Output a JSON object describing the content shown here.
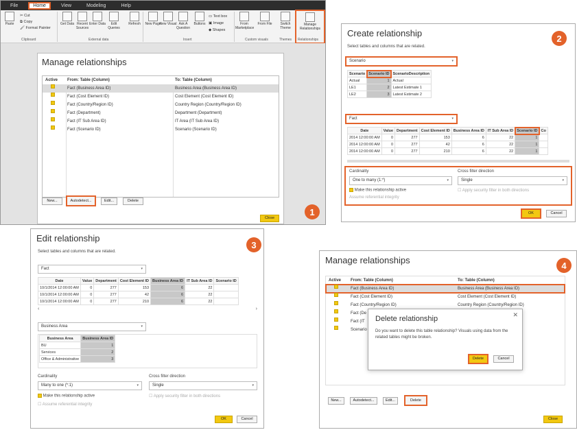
{
  "accent": "#e3622a",
  "yellow": "#f2c811",
  "steps": [
    "1",
    "2",
    "3",
    "4"
  ],
  "panel1": {
    "menu": [
      "File",
      "Home",
      "View",
      "Modeling",
      "Help"
    ],
    "ribbon": {
      "paste": "Paste",
      "cut": "Cut",
      "copy": "Copy",
      "format_painter": "Format Painter",
      "buttons": [
        "Get Data",
        "Recent Sources",
        "Enter Data",
        "Edit Queries",
        "Refresh",
        "New Page",
        "New Visual",
        "Ask A Question",
        "Buttons",
        "From Marketplace",
        "From File",
        "Switch Theme",
        "Manage Relationships"
      ],
      "text_box": "Text box",
      "image": "Image",
      "shapes": "Shapes",
      "groups": [
        "Clipboard",
        "External data",
        "Insert",
        "Custom visuals",
        "Themes",
        "Relationships"
      ]
    },
    "dialog": {
      "title": "Manage relationships",
      "col_active": "Active",
      "col_from": "From: Table (Column)",
      "col_to": "To: Table (Column)",
      "rows": [
        {
          "from": "Fact (Business Area ID)",
          "to": "Business Area (Business Area ID)"
        },
        {
          "from": "Fact (Cost Element ID)",
          "to": "Cost Element (Cost Element ID)"
        },
        {
          "from": "Fact (Country/Region ID)",
          "to": "Country Region (Country/Region ID)"
        },
        {
          "from": "Fact (Department)",
          "to": "Department (Department)"
        },
        {
          "from": "Fact (IT Sub Area ID)",
          "to": "IT Area (IT Sub Area ID)"
        },
        {
          "from": "Fact (Scenario ID)",
          "to": "Scenario (Scenario ID)"
        }
      ],
      "new": "New...",
      "autodetect": "Autodetect...",
      "edit": "Edit...",
      "delete": "Delete",
      "close": "Close"
    }
  },
  "panel2": {
    "title": "Create relationship",
    "subtitle": "Select tables and columns that are related.",
    "table1": "Scenario",
    "t1_headers": [
      "Scenario",
      "Scenario ID",
      "ScenarioDescription"
    ],
    "t1_rows": [
      [
        "Actual",
        "1",
        "Actual"
      ],
      [
        "LE1",
        "2",
        "Latest Estimate 1"
      ],
      [
        "LE2",
        "3",
        "Latest Estimate 2"
      ]
    ],
    "table2": "Fact",
    "t2_headers": [
      "Date",
      "Value",
      "Department",
      "Cost Element ID",
      "Business Area ID",
      "IT Sub Area ID",
      "Scenario ID",
      "Co"
    ],
    "t2_rows": [
      [
        "2014 12:00:00 AM",
        "0",
        "277",
        "153",
        "6",
        "22",
        "1",
        ""
      ],
      [
        "2014 12:00:00 AM",
        "0",
        "277",
        "42",
        "6",
        "22",
        "1",
        ""
      ],
      [
        "2014 12:00:00 AM",
        "0",
        "277",
        "210",
        "6",
        "22",
        "1",
        ""
      ]
    ],
    "cardinality_label": "Cardinality",
    "cardinality": "One to many (1:*)",
    "cross_label": "Cross filter direction",
    "cross": "Single",
    "make_active": "Make this relationship active",
    "assume": "Assume referential integrity",
    "apply_security": "Apply security filter in both directions",
    "ok": "OK",
    "cancel": "Cancel"
  },
  "panel3": {
    "title": "Edit relationship",
    "subtitle": "Select tables and columns that are related.",
    "table1": "Fact",
    "t1_headers": [
      "Date",
      "Value",
      "Department",
      "Cost Element ID",
      "Business Area ID",
      "IT Sub Area ID",
      "Scenario ID"
    ],
    "t1_rows": [
      [
        "10/1/2014 12:00:00 AM",
        "0",
        "277",
        "153",
        "6",
        "22",
        ""
      ],
      [
        "10/1/2014 12:00:00 AM",
        "0",
        "277",
        "42",
        "6",
        "22",
        ""
      ],
      [
        "10/1/2014 12:00:00 AM",
        "0",
        "277",
        "210",
        "6",
        "22",
        ""
      ]
    ],
    "table2": "Business Area",
    "t2_headers": [
      "Business Area",
      "Business Area ID"
    ],
    "t2_rows": [
      [
        "BU",
        "1"
      ],
      [
        "Services",
        "2"
      ],
      [
        "Office & Administrative",
        "3"
      ]
    ],
    "cardinality_label": "Cardinality",
    "cardinality": "Many to one (*:1)",
    "cross_label": "Cross filter direction",
    "cross": "Single",
    "make_active": "Make this relationship active",
    "assume": "Assume referential integrity",
    "apply_security": "Apply security filter in both directions",
    "ok": "OK",
    "cancel": "Cancel"
  },
  "panel4": {
    "title": "Manage relationships",
    "col_active": "Active",
    "col_from": "From: Table (Column)",
    "col_to": "To: Table (Column)",
    "rows": [
      {
        "from": "Fact (Business Area ID)",
        "to": "Business Area (Business Area ID)"
      },
      {
        "from": "Fact (Cost Element ID)",
        "to": "Cost Element (Cost Element ID)"
      },
      {
        "from": "Fact (Country/Region ID)",
        "to": "Country Region (Country/Region ID)"
      },
      {
        "from": "Fact (De",
        "to": ""
      },
      {
        "from": "Fact (IT",
        "to": ""
      },
      {
        "from": "Scenario",
        "to": ""
      }
    ],
    "delete_dialog": {
      "title": "Delete relationship",
      "message": "Do you want to delete this table relationship? Visuals using data from the related tables might be broken.",
      "delete": "Delete",
      "cancel": "Cancel"
    },
    "new": "New...",
    "autodetect": "Autodetect...",
    "edit": "Edit...",
    "delete": "Delete",
    "close": "Close"
  }
}
